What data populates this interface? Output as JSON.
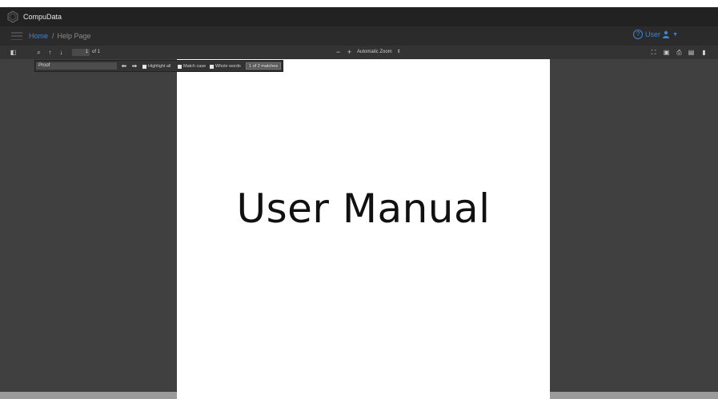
{
  "app": {
    "title": "CompuData"
  },
  "nav": {
    "home": "Home",
    "separator": "/",
    "current": "Help Page",
    "user_label": "User",
    "help_icon": "question-circle-icon"
  },
  "toolbar": {
    "page_number": "1",
    "page_of": "of 1",
    "zoom_minus": "−",
    "zoom_plus": "+",
    "zoom_level": "Automatic Zoom"
  },
  "findbar": {
    "query": "Proof",
    "highlight_all": "Highlight all",
    "match_case": "Match case",
    "whole_words": "Whole words",
    "match_count": "1 of 2 matches"
  },
  "document": {
    "heading": "User Manual"
  },
  "colors": {
    "link": "#3a86d6",
    "viewer_bg": "#404040",
    "toolbar_bg": "#333333"
  }
}
